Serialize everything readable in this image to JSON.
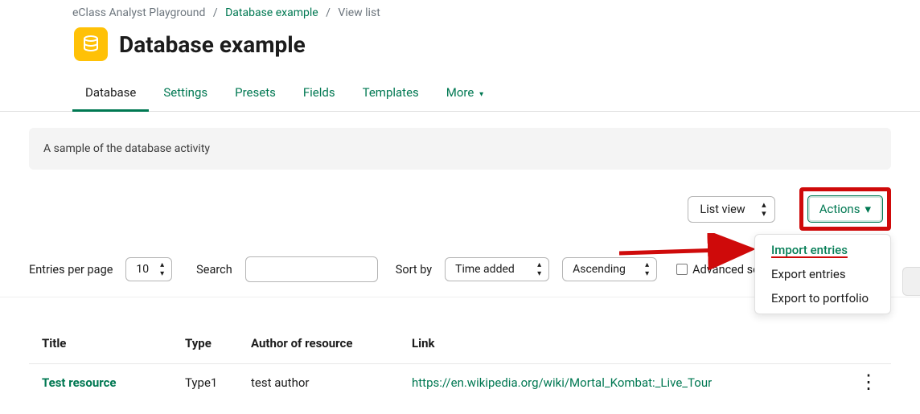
{
  "breadcrumbs": {
    "root": "eClass Analyst Playground",
    "mid": "Database example",
    "current": "View list"
  },
  "page_title": "Database example",
  "tabs": {
    "database": "Database",
    "settings": "Settings",
    "presets": "Presets",
    "fields": "Fields",
    "templates": "Templates",
    "more": "More"
  },
  "info_text": "A sample of the database activity",
  "view_select": {
    "label": "List view"
  },
  "actions_button": "Actions",
  "actions_menu": {
    "import": "Import entries",
    "export": "Export entries",
    "portfolio": "Export to portfolio"
  },
  "filters": {
    "epp_label": "Entries per page",
    "epp_value": "10",
    "search_label": "Search",
    "search_value": "",
    "sortby_label": "Sort by",
    "sortby_value": "Time added",
    "order_value": "Ascending",
    "advanced_label": "Advanced search"
  },
  "table": {
    "headers": {
      "title": "Title",
      "type": "Type",
      "author": "Author of resource",
      "link": "Link"
    },
    "rows": [
      {
        "title": "Test resource",
        "type": "Type1",
        "author": "test author",
        "link": "https://en.wikipedia.org/wiki/Mortal_Kombat:_Live_Tour"
      }
    ]
  }
}
